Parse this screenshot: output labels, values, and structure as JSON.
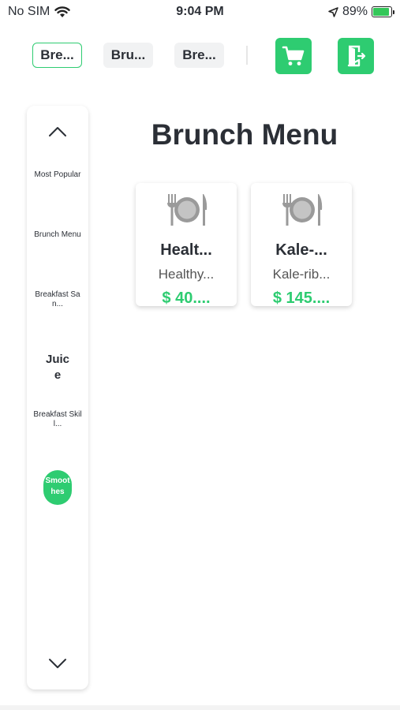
{
  "status_bar": {
    "carrier": "No SIM",
    "time": "9:04 PM",
    "battery": "89%",
    "battery_level": 0.89
  },
  "top_tabs": [
    {
      "label": "Bre..."
    },
    {
      "label": "Bru..."
    },
    {
      "label": "Bre..."
    }
  ],
  "icons": {
    "cart": "shopping-cart-icon",
    "exit": "exit-door-icon"
  },
  "side_menu": {
    "items": [
      {
        "label": "Most Popular"
      },
      {
        "label": "Brunch Menu"
      },
      {
        "label": "Breakfast San..."
      },
      {
        "label": "Juice"
      },
      {
        "label": "Breakfast Skill..."
      },
      {
        "label": "Smoothes"
      }
    ]
  },
  "page_title": "Brunch Menu",
  "cards": [
    {
      "name": "Healt...",
      "desc": "Healthy...",
      "price": "$ 40...."
    },
    {
      "name": "Kale-...",
      "desc": "Kale-rib...",
      "price": "$ 145...."
    }
  ],
  "colors": {
    "accent": "#2ecc71",
    "text": "#2b2f36"
  }
}
